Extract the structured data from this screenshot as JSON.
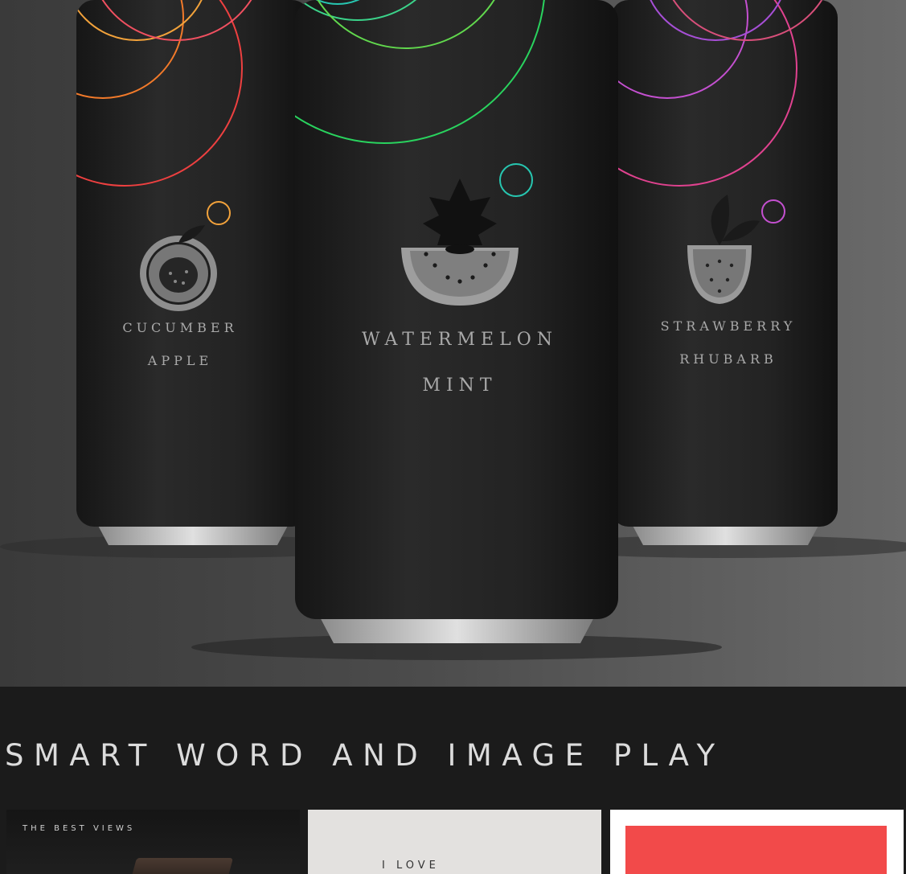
{
  "hero": {
    "cans": [
      {
        "name": "left",
        "line1": "CUCUMBER",
        "line2": "APPLE",
        "icon": "apple-icon"
      },
      {
        "name": "center",
        "line1": "WATERMELON",
        "line2": "MINT",
        "icon": "watermelon-mint-icon"
      },
      {
        "name": "right",
        "line1": "STRAWBERRY",
        "line2": "RHUBARB",
        "icon": "watermelon-strawberry-icon"
      }
    ],
    "colors": {
      "can": "#1e1e1e",
      "ring_green": "#29d35e",
      "ring_orange": "#f2a23b",
      "ring_pink": "#e0428f",
      "label": "#a9a9a9"
    }
  },
  "section": {
    "headline": "SMART WORD AND IMAGE PLAY",
    "cards": [
      {
        "caption": "THE BEST VIEWS"
      },
      {
        "caption": "I LOVE"
      },
      {
        "caption": ""
      }
    ]
  }
}
